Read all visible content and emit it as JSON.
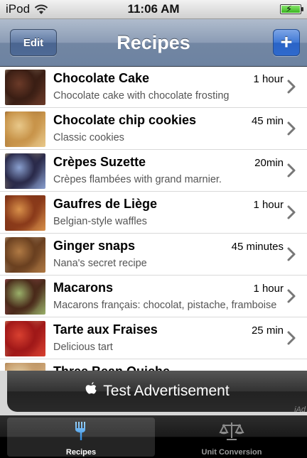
{
  "status_bar": {
    "carrier": "iPod",
    "time": "11:06 AM",
    "wifi_icon": "wifi-icon",
    "battery_icon": "charging-battery-icon"
  },
  "nav_bar": {
    "title": "Recipes",
    "edit_label": "Edit",
    "add_label": "+"
  },
  "recipes": [
    {
      "title": "Chocolate Cake",
      "subtitle": "Chocolate cake with chocolate frosting",
      "time": "1 hour",
      "thumb_colors": [
        "#3a1e14",
        "#6b3a28",
        "#c9b59a"
      ]
    },
    {
      "title": "Chocolate chip cookies",
      "subtitle": "Classic cookies",
      "time": "45 min",
      "thumb_colors": [
        "#c8944a",
        "#e8c88a",
        "#7a4a22"
      ]
    },
    {
      "title": "Crèpes Suzette",
      "subtitle": "Crèpes flambées with grand marnier.",
      "time": "20min",
      "thumb_colors": [
        "#2a2a4a",
        "#8aa0d0",
        "#f0d890"
      ]
    },
    {
      "title": "Gaufres de Liège",
      "subtitle": "Belgian-style waffles",
      "time": "1 hour",
      "thumb_colors": [
        "#8a3a1a",
        "#d8904a",
        "#5a2412"
      ]
    },
    {
      "title": "Ginger snaps",
      "subtitle": "Nana's secret recipe",
      "time": "45 minutes",
      "thumb_colors": [
        "#6a4020",
        "#b07a44",
        "#e8d8c0"
      ]
    },
    {
      "title": "Macarons",
      "subtitle": "Macarons français: chocolat, pistache, framboise",
      "time": "1 hour",
      "thumb_colors": [
        "#4a2a1a",
        "#9ab06a",
        "#d0607a"
      ]
    },
    {
      "title": "Tarte aux Fraises",
      "subtitle": "Delicious tart",
      "time": "25 min",
      "thumb_colors": [
        "#a01818",
        "#d84030",
        "#e8c890"
      ]
    },
    {
      "title": "Three Bean Quiche",
      "subtitle": "",
      "time": "",
      "thumb_colors": [
        "#c8a070",
        "#e8d8b0",
        "#9a7040"
      ]
    }
  ],
  "ad": {
    "icon": "apple-logo-icon",
    "label": "Test Advertisement",
    "iad_label": "iAd"
  },
  "tab_bar": {
    "tabs": [
      {
        "label": "Recipes",
        "icon": "fork-icon",
        "active": true
      },
      {
        "label": "Unit Conversion",
        "icon": "scale-icon",
        "active": false
      }
    ]
  },
  "colors": {
    "nav_bar": "#7b8fab",
    "add_button": "#2f6acd",
    "tab_active_icon": "#5ab0ff"
  }
}
